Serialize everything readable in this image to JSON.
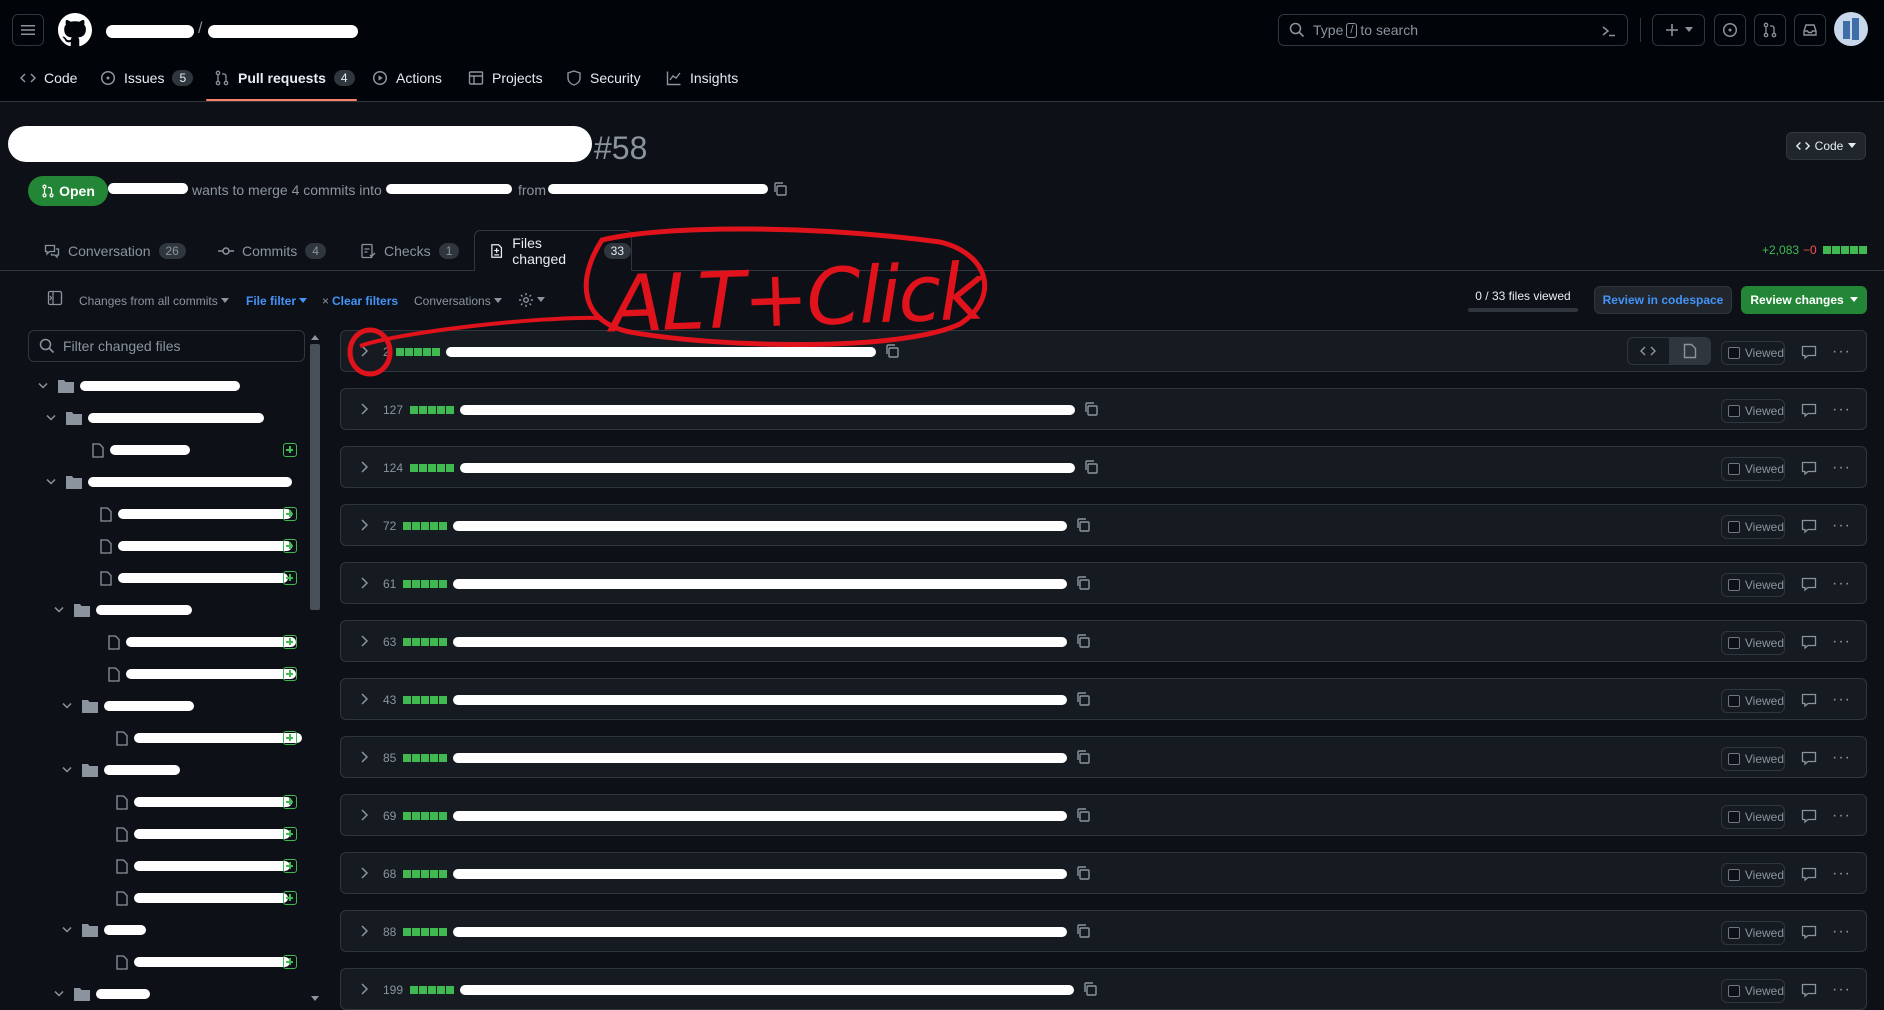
{
  "header": {
    "search_text": "Type / to search",
    "search_before": "Type",
    "search_key": "/",
    "search_after": "to search"
  },
  "nav": {
    "tabs": [
      {
        "label": "Code"
      },
      {
        "label": "Issues",
        "count": "5"
      },
      {
        "label": "Pull requests",
        "count": "4",
        "active": true
      },
      {
        "label": "Actions"
      },
      {
        "label": "Projects"
      },
      {
        "label": "Security"
      },
      {
        "label": "Insights"
      }
    ]
  },
  "pr": {
    "number": "#58",
    "code_button": "Code",
    "status": "Open",
    "merge_text": "wants to merge 4 commits into",
    "from_text": "from"
  },
  "pr_tabs": [
    {
      "label": "Conversation",
      "count": "26"
    },
    {
      "label": "Commits",
      "count": "4"
    },
    {
      "label": "Checks",
      "count": "1"
    },
    {
      "label": "Files changed",
      "count": "33",
      "active": true
    }
  ],
  "diffstat": {
    "additions": "+2,083",
    "deletions": "−0"
  },
  "toolbar": {
    "changes_from": "Changes from all commits",
    "file_filter": "File filter",
    "clear_filters": "Clear filters",
    "conversations": "Conversations",
    "files_viewed": "0 / 33 files viewed",
    "files_viewed_progress": 0,
    "review_codespace": "Review in codespace",
    "review_changes": "Review changes"
  },
  "sidebar": {
    "filter_placeholder": "Filter changed files"
  },
  "file_rows": [
    {
      "additions": "2",
      "viewed_label": "Viewed"
    },
    {
      "additions": "127",
      "viewed_label": "Viewed"
    },
    {
      "additions": "124",
      "viewed_label": "Viewed"
    },
    {
      "additions": "72",
      "viewed_label": "Viewed"
    },
    {
      "additions": "61",
      "viewed_label": "Viewed"
    },
    {
      "additions": "63",
      "viewed_label": "Viewed"
    },
    {
      "additions": "43",
      "viewed_label": "Viewed"
    },
    {
      "additions": "85",
      "viewed_label": "Viewed"
    },
    {
      "additions": "69",
      "viewed_label": "Viewed"
    },
    {
      "additions": "68",
      "viewed_label": "Viewed"
    },
    {
      "additions": "88",
      "viewed_label": "Viewed"
    },
    {
      "additions": "199",
      "viewed_label": "Viewed"
    }
  ],
  "annotation": {
    "text": "ALT+Click",
    "color": "#e0121b"
  },
  "colors": {
    "accent_green": "#238636",
    "added": "#3fb950",
    "link_blue": "#4493f8",
    "tab_underline": "#f78166"
  }
}
